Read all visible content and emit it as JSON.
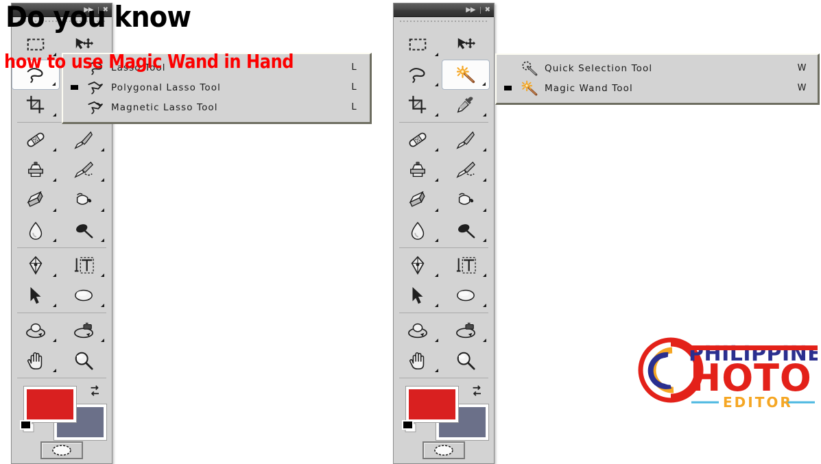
{
  "overlay": {
    "headline": "Do you know",
    "subline": "how to use Magic Wand in Hand"
  },
  "panels": {
    "left": {
      "name": "tools-panel-left",
      "titlebar": {
        "expand_icon": "▶▶",
        "close_icon": "✖"
      },
      "selected_tool": "lasso-tool",
      "tools": [
        [
          {
            "name": "rectangular-marquee-tool",
            "icon": "marquee",
            "has_flyout": true
          },
          {
            "name": "move-tool",
            "icon": "move",
            "has_flyout": false
          }
        ],
        [
          {
            "name": "lasso-tool",
            "icon": "lasso",
            "has_flyout": true
          },
          {
            "name": "magic-wand-tool",
            "icon": "wand",
            "has_flyout": true
          }
        ],
        [
          {
            "name": "crop-tool",
            "icon": "crop",
            "has_flyout": true
          },
          {
            "name": "eyedropper-tool",
            "icon": "eyedropper",
            "has_flyout": true
          }
        ],
        [
          {
            "name": "spot-healing-brush-tool",
            "icon": "bandaid",
            "has_flyout": true
          },
          {
            "name": "brush-tool",
            "icon": "brush",
            "has_flyout": true
          }
        ],
        [
          {
            "name": "clone-stamp-tool",
            "icon": "stamp",
            "has_flyout": true
          },
          {
            "name": "history-brush-tool",
            "icon": "history-brush",
            "has_flyout": true
          }
        ],
        [
          {
            "name": "eraser-tool",
            "icon": "eraser",
            "has_flyout": true
          },
          {
            "name": "gradient-tool",
            "icon": "paint-bucket",
            "has_flyout": true
          }
        ],
        [
          {
            "name": "blur-tool",
            "icon": "blur",
            "has_flyout": true
          },
          {
            "name": "dodge-tool",
            "icon": "dodge",
            "has_flyout": true
          }
        ],
        [
          {
            "name": "pen-tool",
            "icon": "pen",
            "has_flyout": true
          },
          {
            "name": "horizontal-type-tool",
            "icon": "type",
            "has_flyout": true
          }
        ],
        [
          {
            "name": "path-selection-tool",
            "icon": "path-arrow",
            "has_flyout": true
          },
          {
            "name": "ellipse-shape-tool",
            "icon": "ellipse",
            "has_flyout": true
          }
        ],
        [
          {
            "name": "3d-rotate-tool",
            "icon": "orbit",
            "has_flyout": true
          },
          {
            "name": "3d-camera-rotate-tool",
            "icon": "orbit-cam",
            "has_flyout": true
          }
        ],
        [
          {
            "name": "hand-tool",
            "icon": "hand",
            "has_flyout": true
          },
          {
            "name": "zoom-tool",
            "icon": "magnifier",
            "has_flyout": false
          }
        ]
      ],
      "colors": {
        "foreground": "#d92020",
        "background": "#6b7089"
      },
      "quick_mask": {
        "name": "quick-mask-button",
        "icon": "ellipse-mask"
      }
    },
    "right": {
      "name": "tools-panel-right",
      "titlebar": {
        "expand_icon": "▶▶",
        "close_icon": "✖"
      },
      "selected_tool": "magic-wand-tool"
    }
  },
  "flyouts": {
    "lasso": {
      "name": "lasso-tool-flyout",
      "active_index": 1,
      "items": [
        {
          "label": "Lasso Tool",
          "shortcut": "L",
          "icon": "lasso"
        },
        {
          "label": "Polygonal Lasso Tool",
          "shortcut": "L",
          "icon": "polygonal-lasso"
        },
        {
          "label": "Magnetic Lasso Tool",
          "shortcut": "L",
          "icon": "magnetic-lasso"
        }
      ]
    },
    "wand": {
      "name": "magic-wand-tool-flyout",
      "active_index": 1,
      "items": [
        {
          "label": "Quick Selection Tool",
          "shortcut": "W",
          "icon": "quick-selection"
        },
        {
          "label": "Magic Wand Tool",
          "shortcut": "W",
          "icon": "wand"
        }
      ]
    }
  },
  "logo": {
    "name": "philippines-photo-editor-logo",
    "line1": "PHILIPPINES",
    "line2": "HOTO",
    "line3": "EDITOR",
    "colors": {
      "red": "#e32119",
      "blue": "#2a2f8f",
      "orange": "#f5a623",
      "lightblue": "#4ab7e0"
    }
  }
}
